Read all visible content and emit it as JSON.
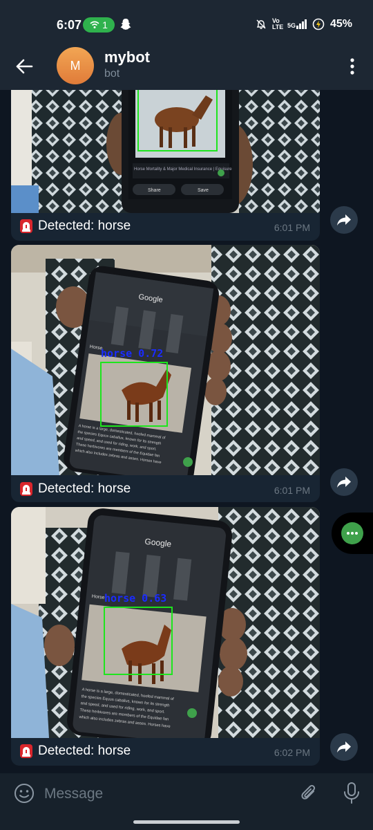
{
  "status_bar": {
    "time": "6:07",
    "hotspot_count": "1",
    "network": "5G",
    "volte": "Vo LTE",
    "battery": "45%"
  },
  "header": {
    "back_icon": "arrow-left-icon",
    "avatar_letter": "M",
    "title": "mybot",
    "subtitle": "bot",
    "menu_icon": "more-vertical-icon"
  },
  "messages": [
    {
      "caption": "Detected: horse",
      "time": "6:01 PM",
      "icon": "siren-icon"
    },
    {
      "caption": "Detected: horse",
      "time": "6:01 PM",
      "icon": "siren-icon",
      "detection_label": "horse  0.72"
    },
    {
      "caption": "Detected: horse",
      "time": "6:02 PM",
      "icon": "siren-icon",
      "detection_label": "horse  0.63"
    }
  ],
  "phone_screen": {
    "search_brand": "Google",
    "result_heading": "Horse",
    "description_lines": [
      "A horse is a large, domesticated, hoofed mammal of",
      "the species Equus caballus, known for its strength",
      "and speed, and used for riding, work, and sport.",
      "These herbivores are members of the Equidae fan",
      "which also includes zebras and asses. Horses have"
    ],
    "top_card_title": "Horse Mortality & Major Medical Insurance | Equisure",
    "top_card_share": "Share",
    "top_card_save": "Save"
  },
  "input_bar": {
    "placeholder": "Message"
  },
  "colors": {
    "chat_bg": "#0e1621",
    "bubble_bg": "#182533",
    "header_bg": "#1d2733",
    "detection_box": "#1de51d",
    "detection_label": "#1a2bff",
    "hotspot_green": "#2fb24d",
    "avatar_orange": "#e88a3f"
  }
}
